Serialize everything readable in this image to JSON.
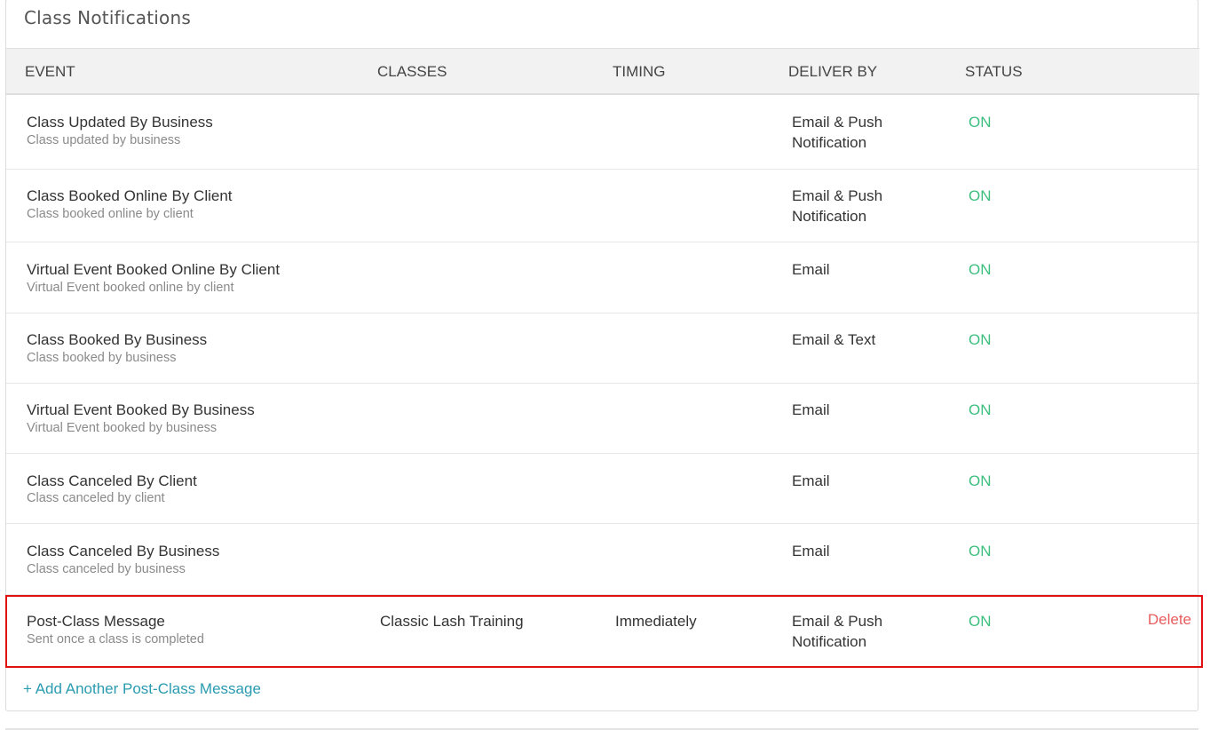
{
  "panel": {
    "title": "Class Notifications"
  },
  "table": {
    "headers": {
      "event": "EVENT",
      "classes": "CLASSES",
      "timing": "TIMING",
      "deliver_by": "DELIVER BY",
      "status": "STATUS"
    },
    "rows": [
      {
        "title": "Class Updated By Business",
        "subtitle": "Class updated by business",
        "deliver_line1": "Email & Push",
        "deliver_line2": "Notification",
        "status": "ON"
      },
      {
        "title": "Class Booked Online By Client",
        "subtitle": "Class booked online by client",
        "deliver_line1": "Email & Push",
        "deliver_line2": "Notification",
        "status": "ON"
      },
      {
        "title": "Virtual Event Booked Online By Client",
        "subtitle": "Virtual Event booked online by client",
        "deliver_line1": "Email",
        "deliver_line2": "",
        "status": "ON"
      },
      {
        "title": "Class Booked By Business",
        "subtitle": "Class booked by business",
        "deliver_line1": "Email & Text",
        "deliver_line2": "",
        "status": "ON"
      },
      {
        "title": "Virtual Event Booked By Business",
        "subtitle": "Virtual Event booked by business",
        "deliver_line1": "Email",
        "deliver_line2": "",
        "status": "ON"
      },
      {
        "title": "Class Canceled By Client",
        "subtitle": "Class canceled by client",
        "deliver_line1": "Email",
        "deliver_line2": "",
        "status": "ON"
      },
      {
        "title": "Class Canceled By Business",
        "subtitle": "Class canceled by business",
        "deliver_line1": "Email",
        "deliver_line2": "",
        "status": "ON"
      },
      {
        "title": "Post-Class Message",
        "subtitle": "Sent once a class is completed",
        "classes": "Classic Lash Training",
        "timing": "Immediately",
        "deliver_line1": "Email & Push",
        "deliver_line2": "Notification",
        "status": "ON",
        "action": "Delete"
      }
    ]
  },
  "add_link": "+ Add Another Post-Class Message",
  "colors": {
    "status_on": "#3cbf7e",
    "delete": "#e85d5d",
    "link": "#2a9bb0",
    "highlight": "#e01010"
  }
}
